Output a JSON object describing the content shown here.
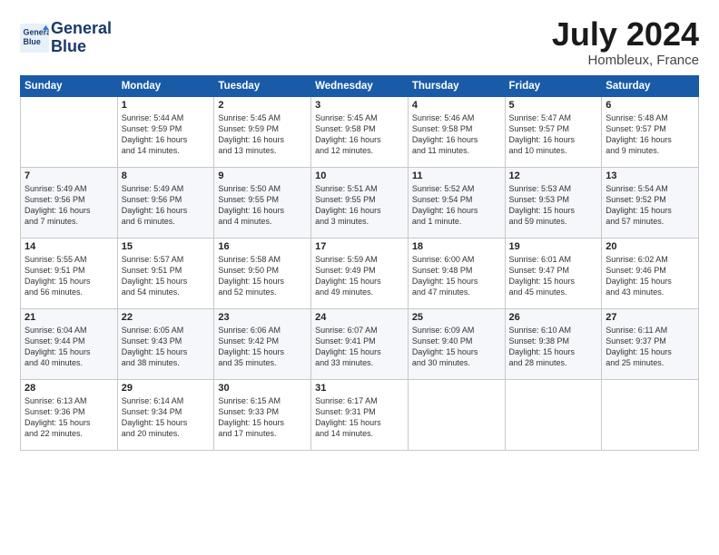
{
  "header": {
    "logo_line1": "General",
    "logo_line2": "Blue",
    "month": "July 2024",
    "location": "Hombleux, France"
  },
  "weekdays": [
    "Sunday",
    "Monday",
    "Tuesday",
    "Wednesday",
    "Thursday",
    "Friday",
    "Saturday"
  ],
  "weeks": [
    [
      {
        "day": "",
        "info": ""
      },
      {
        "day": "1",
        "info": "Sunrise: 5:44 AM\nSunset: 9:59 PM\nDaylight: 16 hours\nand 14 minutes."
      },
      {
        "day": "2",
        "info": "Sunrise: 5:45 AM\nSunset: 9:59 PM\nDaylight: 16 hours\nand 13 minutes."
      },
      {
        "day": "3",
        "info": "Sunrise: 5:45 AM\nSunset: 9:58 PM\nDaylight: 16 hours\nand 12 minutes."
      },
      {
        "day": "4",
        "info": "Sunrise: 5:46 AM\nSunset: 9:58 PM\nDaylight: 16 hours\nand 11 minutes."
      },
      {
        "day": "5",
        "info": "Sunrise: 5:47 AM\nSunset: 9:57 PM\nDaylight: 16 hours\nand 10 minutes."
      },
      {
        "day": "6",
        "info": "Sunrise: 5:48 AM\nSunset: 9:57 PM\nDaylight: 16 hours\nand 9 minutes."
      }
    ],
    [
      {
        "day": "7",
        "info": "Sunrise: 5:49 AM\nSunset: 9:56 PM\nDaylight: 16 hours\nand 7 minutes."
      },
      {
        "day": "8",
        "info": "Sunrise: 5:49 AM\nSunset: 9:56 PM\nDaylight: 16 hours\nand 6 minutes."
      },
      {
        "day": "9",
        "info": "Sunrise: 5:50 AM\nSunset: 9:55 PM\nDaylight: 16 hours\nand 4 minutes."
      },
      {
        "day": "10",
        "info": "Sunrise: 5:51 AM\nSunset: 9:55 PM\nDaylight: 16 hours\nand 3 minutes."
      },
      {
        "day": "11",
        "info": "Sunrise: 5:52 AM\nSunset: 9:54 PM\nDaylight: 16 hours\nand 1 minute."
      },
      {
        "day": "12",
        "info": "Sunrise: 5:53 AM\nSunset: 9:53 PM\nDaylight: 15 hours\nand 59 minutes."
      },
      {
        "day": "13",
        "info": "Sunrise: 5:54 AM\nSunset: 9:52 PM\nDaylight: 15 hours\nand 57 minutes."
      }
    ],
    [
      {
        "day": "14",
        "info": "Sunrise: 5:55 AM\nSunset: 9:51 PM\nDaylight: 15 hours\nand 56 minutes."
      },
      {
        "day": "15",
        "info": "Sunrise: 5:57 AM\nSunset: 9:51 PM\nDaylight: 15 hours\nand 54 minutes."
      },
      {
        "day": "16",
        "info": "Sunrise: 5:58 AM\nSunset: 9:50 PM\nDaylight: 15 hours\nand 52 minutes."
      },
      {
        "day": "17",
        "info": "Sunrise: 5:59 AM\nSunset: 9:49 PM\nDaylight: 15 hours\nand 49 minutes."
      },
      {
        "day": "18",
        "info": "Sunrise: 6:00 AM\nSunset: 9:48 PM\nDaylight: 15 hours\nand 47 minutes."
      },
      {
        "day": "19",
        "info": "Sunrise: 6:01 AM\nSunset: 9:47 PM\nDaylight: 15 hours\nand 45 minutes."
      },
      {
        "day": "20",
        "info": "Sunrise: 6:02 AM\nSunset: 9:46 PM\nDaylight: 15 hours\nand 43 minutes."
      }
    ],
    [
      {
        "day": "21",
        "info": "Sunrise: 6:04 AM\nSunset: 9:44 PM\nDaylight: 15 hours\nand 40 minutes."
      },
      {
        "day": "22",
        "info": "Sunrise: 6:05 AM\nSunset: 9:43 PM\nDaylight: 15 hours\nand 38 minutes."
      },
      {
        "day": "23",
        "info": "Sunrise: 6:06 AM\nSunset: 9:42 PM\nDaylight: 15 hours\nand 35 minutes."
      },
      {
        "day": "24",
        "info": "Sunrise: 6:07 AM\nSunset: 9:41 PM\nDaylight: 15 hours\nand 33 minutes."
      },
      {
        "day": "25",
        "info": "Sunrise: 6:09 AM\nSunset: 9:40 PM\nDaylight: 15 hours\nand 30 minutes."
      },
      {
        "day": "26",
        "info": "Sunrise: 6:10 AM\nSunset: 9:38 PM\nDaylight: 15 hours\nand 28 minutes."
      },
      {
        "day": "27",
        "info": "Sunrise: 6:11 AM\nSunset: 9:37 PM\nDaylight: 15 hours\nand 25 minutes."
      }
    ],
    [
      {
        "day": "28",
        "info": "Sunrise: 6:13 AM\nSunset: 9:36 PM\nDaylight: 15 hours\nand 22 minutes."
      },
      {
        "day": "29",
        "info": "Sunrise: 6:14 AM\nSunset: 9:34 PM\nDaylight: 15 hours\nand 20 minutes."
      },
      {
        "day": "30",
        "info": "Sunrise: 6:15 AM\nSunset: 9:33 PM\nDaylight: 15 hours\nand 17 minutes."
      },
      {
        "day": "31",
        "info": "Sunrise: 6:17 AM\nSunset: 9:31 PM\nDaylight: 15 hours\nand 14 minutes."
      },
      {
        "day": "",
        "info": ""
      },
      {
        "day": "",
        "info": ""
      },
      {
        "day": "",
        "info": ""
      }
    ]
  ]
}
